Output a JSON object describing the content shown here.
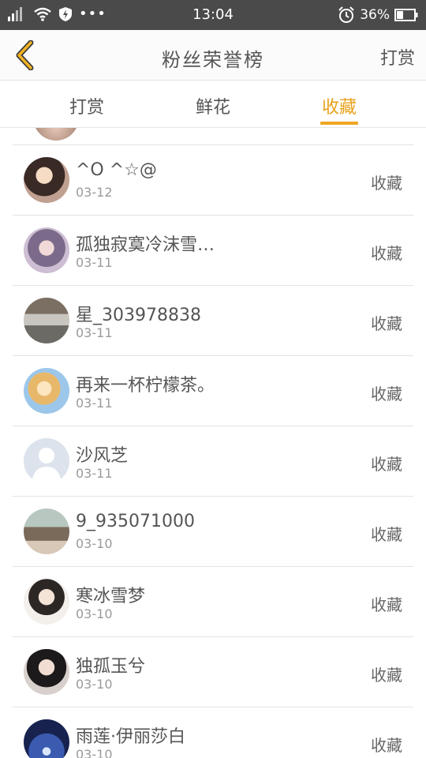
{
  "status_bar": {
    "time": "13:04",
    "battery": "36%"
  },
  "header": {
    "title": "粉丝荣誉榜",
    "right_action": "打赏"
  },
  "tabs": [
    {
      "label": "打赏"
    },
    {
      "label": "鲜花"
    },
    {
      "label": "收藏"
    }
  ],
  "selected_tab": "收藏",
  "colors": {
    "accent": "#f0a623",
    "status_bar_bg": "#4a4a4a"
  },
  "fans": [
    {
      "name": "    ^O ^☆@",
      "date": "03-12",
      "action": "收藏"
    },
    {
      "name": "孤独寂寞冷沫雪…",
      "date": "03-11",
      "action": "收藏"
    },
    {
      "name": "星_303978838",
      "date": "03-11",
      "action": "收藏"
    },
    {
      "name": "再来一杯柠檬茶。",
      "date": "03-11",
      "action": "收藏"
    },
    {
      "name": "沙风芝",
      "date": "03-11",
      "action": "收藏"
    },
    {
      "name": "9_935071000",
      "date": "03-10",
      "action": "收藏"
    },
    {
      "name": "寒冰雪梦",
      "date": "03-10",
      "action": "收藏"
    },
    {
      "name": "独孤玉兮",
      "date": "03-10",
      "action": "收藏"
    },
    {
      "name": "雨莲·伊丽莎白",
      "date": "03-10",
      "action": "收藏"
    }
  ]
}
